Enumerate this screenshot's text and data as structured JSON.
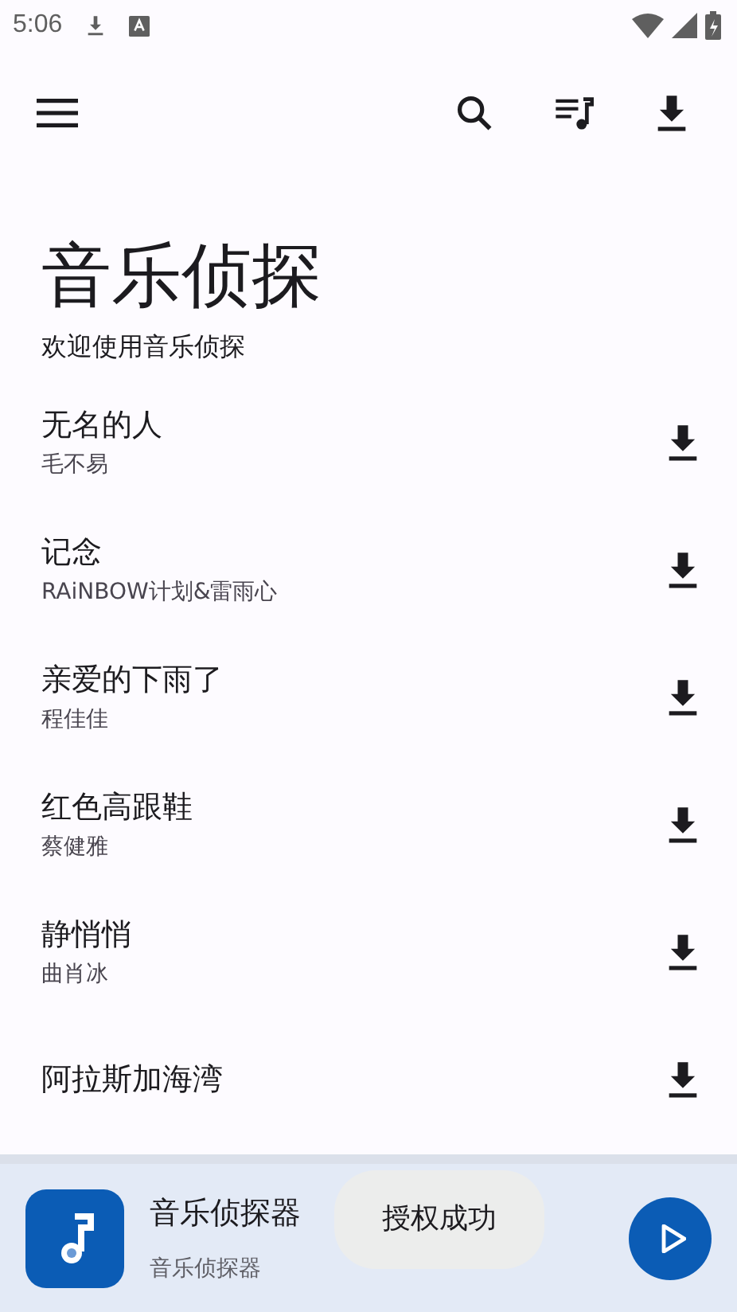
{
  "status_bar": {
    "time": "5:06"
  },
  "toolbar": {
    "actions": [
      {
        "kind": "search"
      },
      {
        "kind": "queue"
      },
      {
        "kind": "download"
      }
    ]
  },
  "header": {
    "title": "音乐侦探",
    "subtitle": "欢迎使用音乐侦探"
  },
  "songs": [
    {
      "title": "无名的人",
      "artist": "毛不易"
    },
    {
      "title": "记念",
      "artist": "RAiNBOW计划&雷雨心"
    },
    {
      "title": "亲爱的下雨了",
      "artist": "程佳佳"
    },
    {
      "title": "红色高跟鞋",
      "artist": "蔡健雅"
    },
    {
      "title": "静悄悄",
      "artist": "曲肖冰"
    },
    {
      "title": "阿拉斯加海湾"
    }
  ],
  "player": {
    "title": "音乐侦探器",
    "subtitle": "音乐侦探器",
    "playing": false
  },
  "toast": {
    "text": "授权成功"
  }
}
